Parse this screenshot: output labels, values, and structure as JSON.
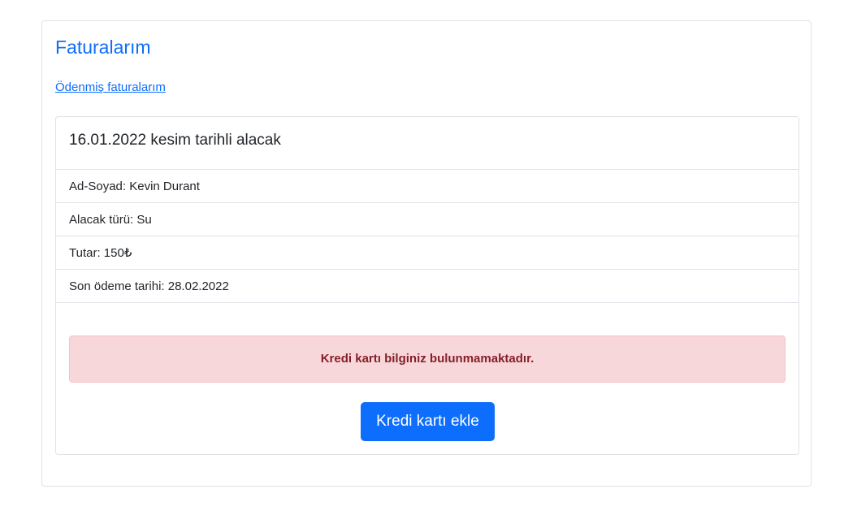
{
  "page": {
    "title": "Faturalarım",
    "paid_invoices_link": "Ödenmiş faturalarım"
  },
  "invoice": {
    "header": "16.01.2022 kesim tarihli alacak",
    "details": [
      {
        "label": "Ad-Soyad:",
        "value": "Kevin Durant"
      },
      {
        "label": "Alacak türü:",
        "value": "Su"
      },
      {
        "label": "Tutar:",
        "value": "150₺"
      },
      {
        "label": "Son ödeme tarihi:",
        "value": "28.02.2022"
      }
    ],
    "alert": "Kredi kartı bilginiz bulunmamaktadır.",
    "add_card_button": "Kredi kartı ekle"
  },
  "colors": {
    "primary": "#0d6efd",
    "alert_background": "#f8d7da",
    "alert_text": "#842029",
    "border": "#dee2e6"
  }
}
